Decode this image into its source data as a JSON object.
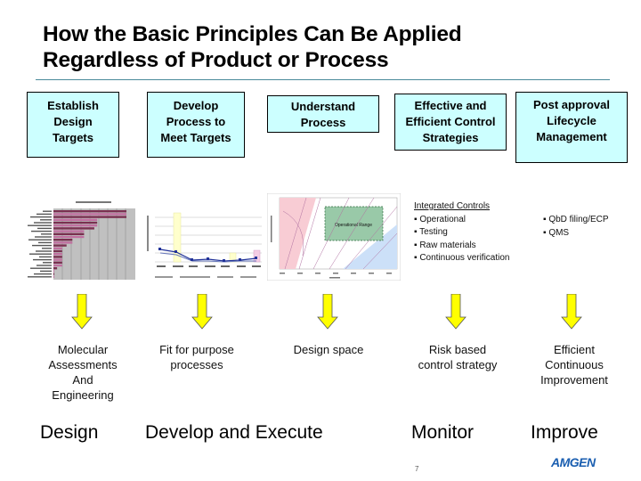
{
  "slide": {
    "title_line1": "How the Basic Principles Can Be Applied",
    "title_line2": "Regardless of Product or Process",
    "page_number": "7",
    "logo_text": "AMGEN"
  },
  "stages": [
    {
      "lines": [
        "Establish",
        "Design",
        "Targets"
      ]
    },
    {
      "lines": [
        "Develop",
        "Process to",
        "Meet Targets"
      ]
    },
    {
      "lines": [
        "Understand",
        "Process"
      ]
    },
    {
      "lines": [
        "Effective and",
        "Efficient Control",
        "Strategies"
      ]
    },
    {
      "lines": [
        "Post approval",
        "Lifecycle",
        "Management"
      ]
    }
  ],
  "thumbnails": {
    "bar_chart": {
      "label": "molecular-assessment-bar-chart"
    },
    "line_chart": {
      "label": "process-fit-line-chart"
    },
    "design_space": {
      "label": "design-space-contour-plot",
      "region_label": "Operational Range"
    }
  },
  "control_list": {
    "header": "Integrated Controls",
    "items": [
      "Operational",
      "Testing",
      "Raw materials",
      "Continuous verification"
    ]
  },
  "lifecycle_list": {
    "items": [
      "QbD filing/ECP",
      "QMS"
    ]
  },
  "outcomes": [
    {
      "lines": [
        "Molecular",
        "Assessments",
        "And",
        "Engineering"
      ]
    },
    {
      "lines": [
        "Fit for purpose",
        "processes"
      ]
    },
    {
      "lines": [
        "Design space"
      ]
    },
    {
      "lines": [
        "Risk based",
        "control strategy"
      ]
    },
    {
      "lines": [
        "Efficient",
        "Continuous",
        "Improvement"
      ]
    }
  ],
  "phases": [
    "Design",
    "Develop and Execute",
    "Monitor",
    "Improve"
  ],
  "colors": {
    "box_fill": "#ccffff",
    "arrow_fill": "#ffff00",
    "rule": "#4a8a9a",
    "logo": "#1a5eb0"
  }
}
